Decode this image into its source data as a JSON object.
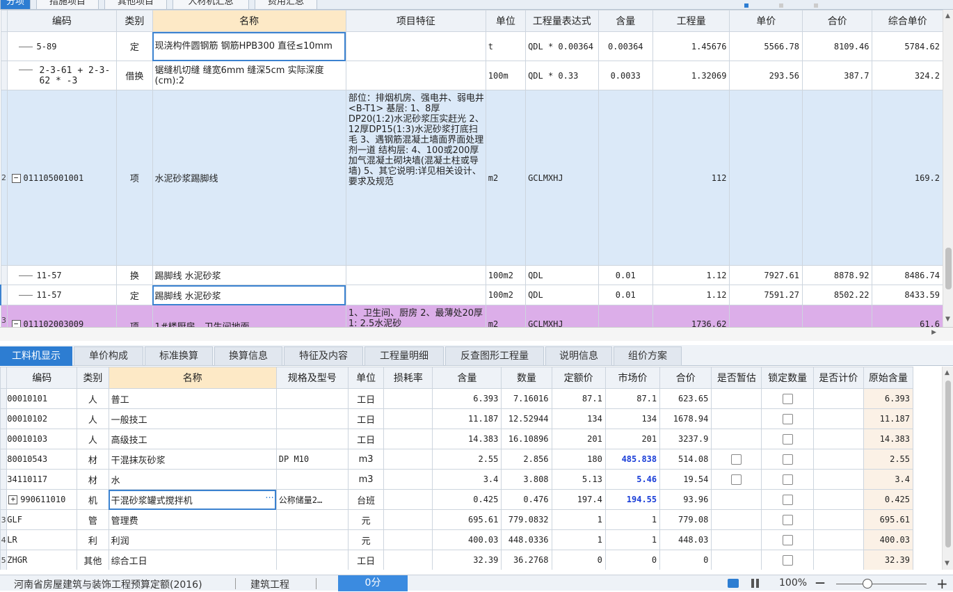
{
  "top_tabs": [
    "分项",
    "措施项目",
    "其他项目",
    "人材机汇总",
    "费用汇总"
  ],
  "upper_table": {
    "headers": [
      "编码",
      "类别",
      "名称",
      "项目特征",
      "单位",
      "工程量表达式",
      "含量",
      "工程量",
      "单价",
      "合价",
      "综合单价"
    ],
    "rows": [
      {
        "rn": "",
        "code": "5-89",
        "type": "定",
        "name": "现浇构件圆钢筋 钢筋HPB300 直径≤10mm",
        "feature": "",
        "unit": "t",
        "expr": "QDL * 0.00364",
        "content": "0.00364",
        "qty": "1.45676",
        "price": "5566.78",
        "total": "8109.46",
        "comp": "5784.62"
      },
      {
        "rn": "",
        "code": "2-3-61 + 2-3-62 * -3",
        "type": "借换",
        "name": "锯缝机切缝 缝宽6mm 缝深5cm 实际深度(cm):2",
        "feature": "",
        "unit": "100m",
        "expr": "QDL * 0.33",
        "content": "0.0033",
        "qty": "1.32069",
        "price": "293.56",
        "total": "387.7",
        "comp": "324.2"
      },
      {
        "rn": "2",
        "code": "011105001001",
        "type": "项",
        "name": "水泥砂浆踢脚线",
        "feature": "部位：排烟机房、强电井、弱电井<B-T1>\n基层:\n1、8厚DP20(1:2)水泥砂浆压实赶光\n2、12厚DP15(1:3)水泥砂浆打底扫毛\n3、遇钢筋混凝土墙面界面处理剂一道\n结构层:\n4、100或200厚加气混凝土砌块墙(混凝土柱或导墙)\n5、其它说明:详见相关设计、要求及规范",
        "unit": "m2",
        "expr": "GCLMXHJ",
        "content": "",
        "qty": "112",
        "price": "",
        "total": "",
        "comp": "169.2"
      },
      {
        "rn": "",
        "code": "11-57",
        "type": "换",
        "name": "踢脚线 水泥砂浆",
        "feature": "",
        "unit": "100m2",
        "expr": "QDL",
        "content": "0.01",
        "qty": "1.12",
        "price": "7927.61",
        "total": "8878.92",
        "comp": "8486.74"
      },
      {
        "rn": "",
        "code": "11-57",
        "type": "定",
        "name": "踢脚线 水泥砂浆",
        "feature": "",
        "unit": "100m2",
        "expr": "QDL",
        "content": "0.01",
        "qty": "1.12",
        "price": "7591.27",
        "total": "8502.22",
        "comp": "8433.59"
      },
      {
        "rn": "3",
        "code": "011102003009",
        "type": "项",
        "name": "1#楼厨房、卫生间地面",
        "feature": "1、卫生间、厨房\n2、最薄处20厚1: 2.5水泥砂",
        "unit": "m2",
        "expr": "GCLMXHJ",
        "content": "",
        "qty": "1736.62",
        "price": "",
        "total": "",
        "comp": "61.6"
      }
    ]
  },
  "bottom_tabs": [
    "工料机显示",
    "单价构成",
    "标准换算",
    "换算信息",
    "特征及内容",
    "工程量明细",
    "反查图形工程量",
    "说明信息",
    "组价方案"
  ],
  "lower_table": {
    "headers": [
      "编码",
      "类别",
      "名称",
      "规格及型号",
      "单位",
      "损耗率",
      "含量",
      "数量",
      "定额价",
      "市场价",
      "合价",
      "是否暂估",
      "锁定数量",
      "是否计价",
      "原始含量"
    ],
    "rows": [
      {
        "rn": "",
        "code": "00010101",
        "type": "人",
        "name": "普工",
        "spec": "",
        "unit": "工日",
        "loss": "",
        "content": "6.393",
        "qty": "7.16016",
        "quota": "87.1",
        "market": "87.1",
        "total": "623.65",
        "est": false,
        "lock": true,
        "orig": "6.393",
        "blue": false
      },
      {
        "rn": "",
        "code": "00010102",
        "type": "人",
        "name": "一般技工",
        "spec": "",
        "unit": "工日",
        "loss": "",
        "content": "11.187",
        "qty": "12.52944",
        "quota": "134",
        "market": "134",
        "total": "1678.94",
        "est": false,
        "lock": true,
        "orig": "11.187",
        "blue": false
      },
      {
        "rn": "",
        "code": "00010103",
        "type": "人",
        "name": "高级技工",
        "spec": "",
        "unit": "工日",
        "loss": "",
        "content": "14.383",
        "qty": "16.10896",
        "quota": "201",
        "market": "201",
        "total": "3237.9",
        "est": false,
        "lock": true,
        "orig": "14.383",
        "blue": false
      },
      {
        "rn": "",
        "code": "80010543",
        "type": "材",
        "name": "干混抹灰砂浆",
        "spec": "DP M10",
        "unit": "m3",
        "loss": "",
        "content": "2.55",
        "qty": "2.856",
        "quota": "180",
        "market": "485.838",
        "total": "514.08",
        "est": true,
        "lock": true,
        "orig": "2.55",
        "blue": true
      },
      {
        "rn": "",
        "code": "34110117",
        "type": "材",
        "name": "水",
        "spec": "",
        "unit": "m3",
        "loss": "",
        "content": "3.4",
        "qty": "3.808",
        "quota": "5.13",
        "market": "5.46",
        "total": "19.54",
        "est": true,
        "lock": true,
        "orig": "3.4",
        "blue": true
      },
      {
        "rn": "",
        "code": "990611010",
        "type": "机",
        "name": "干混砂浆罐式搅拌机",
        "spec": "公称储量2…",
        "unit": "台班",
        "loss": "",
        "content": "0.425",
        "qty": "0.476",
        "quota": "197.4",
        "market": "194.55",
        "total": "93.96",
        "est": false,
        "lock": true,
        "orig": "0.425",
        "blue": true
      },
      {
        "rn": "3",
        "code": "GLF",
        "type": "管",
        "name": "管理费",
        "spec": "",
        "unit": "元",
        "loss": "",
        "content": "695.61",
        "qty": "779.0832",
        "quota": "1",
        "market": "1",
        "total": "779.08",
        "est": false,
        "lock": true,
        "orig": "695.61",
        "blue": false
      },
      {
        "rn": "4",
        "code": "LR",
        "type": "利",
        "name": "利润",
        "spec": "",
        "unit": "元",
        "loss": "",
        "content": "400.03",
        "qty": "448.0336",
        "quota": "1",
        "market": "1",
        "total": "448.03",
        "est": false,
        "lock": true,
        "orig": "400.03",
        "blue": false
      },
      {
        "rn": "5",
        "code": "ZHGR",
        "type": "其他",
        "name": "综合工日",
        "spec": "",
        "unit": "工日",
        "loss": "",
        "content": "32.39",
        "qty": "36.2768",
        "quota": "0",
        "market": "0",
        "total": "0",
        "est": false,
        "lock": true,
        "orig": "32.39",
        "blue": false
      }
    ]
  },
  "status": {
    "quota_lib": "河南省房屋建筑与装饰工程预算定额(2016)",
    "project_type": "建筑工程",
    "score": "0分",
    "zoom": "100%",
    "minus": "—",
    "plus": "+"
  }
}
